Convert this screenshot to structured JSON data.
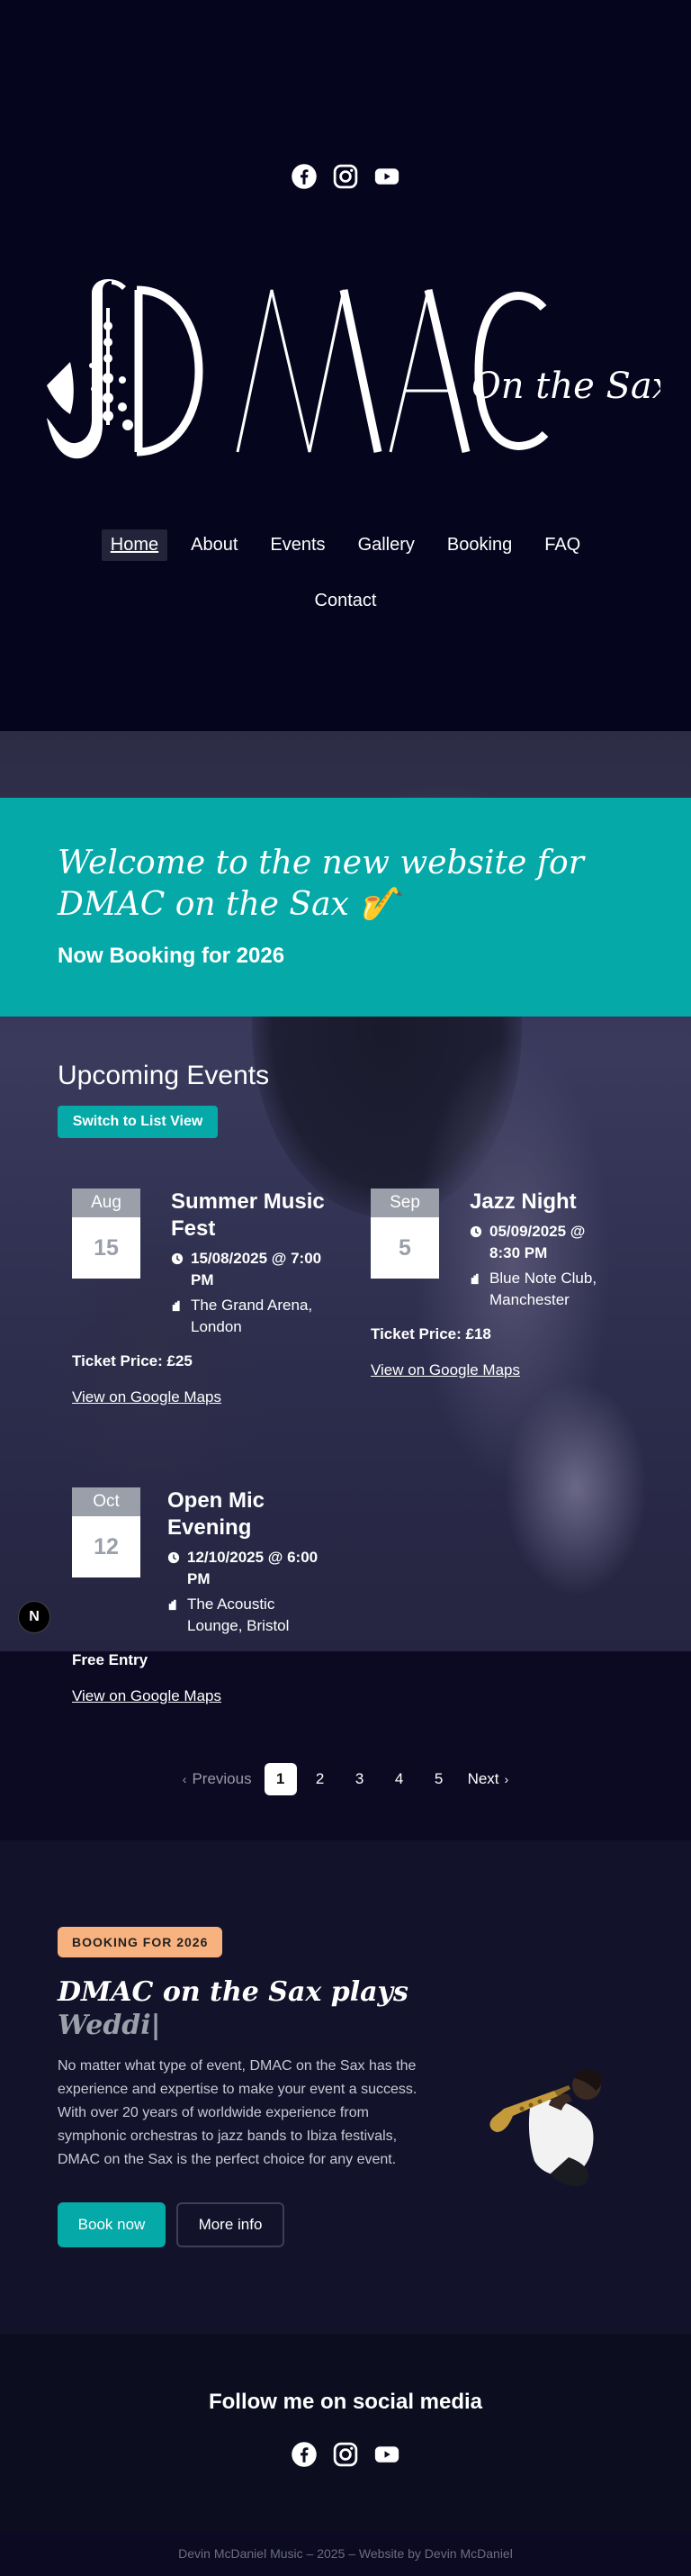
{
  "header": {
    "social": [
      "facebook-icon",
      "instagram-icon",
      "youtube-icon"
    ],
    "logo": {
      "main": "DMAC",
      "tagline": "On the Sax"
    },
    "nav": [
      {
        "label": "Home",
        "active": true
      },
      {
        "label": "About"
      },
      {
        "label": "Events"
      },
      {
        "label": "Gallery"
      },
      {
        "label": "Booking"
      },
      {
        "label": "FAQ"
      },
      {
        "label": "Contact"
      }
    ]
  },
  "welcome": {
    "title": "Welcome to the new website for DMAC on the Sax 🎷",
    "subtitle": "Now Booking for 2026"
  },
  "events": {
    "title": "Upcoming Events",
    "switch_label": "Switch to List View",
    "items": [
      {
        "month": "Aug",
        "day": "15",
        "title": "Summer Music Fest",
        "datetime": "15/08/2025 @ 7:00 PM",
        "venue": "The Grand Arena, London",
        "price": "Ticket Price: £25",
        "maps": "View on Google Maps"
      },
      {
        "month": "Sep",
        "day": "5",
        "title": "Jazz Night",
        "datetime": "05/09/2025 @ 8:30 PM",
        "venue": "Blue Note Club, Manchester",
        "price": "Ticket Price: £18",
        "maps": "View on Google Maps"
      },
      {
        "month": "Oct",
        "day": "12",
        "title": "Open Mic Evening",
        "datetime": "12/10/2025 @ 6:00 PM",
        "venue": "The Acoustic Lounge, Bristol",
        "price": "Free Entry",
        "maps": "View on Google Maps"
      }
    ]
  },
  "pagination": {
    "prev": "Previous",
    "pages": [
      "1",
      "2",
      "3",
      "4",
      "5"
    ],
    "current": "1",
    "next": "Next"
  },
  "booking": {
    "badge": "BOOKING FOR 2026",
    "heading": "DMAC on the Sax plays",
    "typed": "Weddi|",
    "body": "No matter what type of event, DMAC on the Sax has the experience and expertise to make your event a success. With over 20 years of worldwide experience from symphonic orchestras to jazz bands to Ibiza festivals, DMAC on the Sax is the perfect choice for any event.",
    "book_label": "Book now",
    "more_label": "More info"
  },
  "footer": {
    "follow_title": "Follow me on social media",
    "social": [
      "facebook-icon",
      "instagram-icon",
      "youtube-icon"
    ],
    "copyright": "Devin McDaniel Music – 2025 – Website by Devin McDaniel"
  },
  "colors": {
    "teal": "#05a9a8",
    "badge": "#f8b27f",
    "header_bg": "#06051e"
  },
  "floating_badge": "N"
}
